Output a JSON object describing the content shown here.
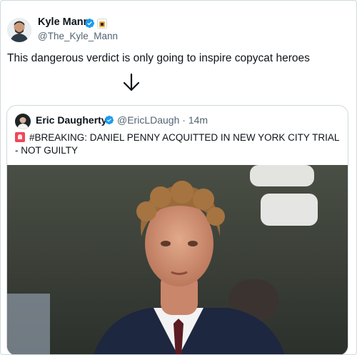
{
  "tweet": {
    "author_name": "Kyle Mann",
    "author_handle": "@The_Kyle_Mann",
    "text": "This dangerous verdict is only going to inspire copycat heroes",
    "arrow_icon": "arrow-down-icon"
  },
  "quote": {
    "author_name": "Eric Daugherty",
    "author_handle": "@EricLDaugh",
    "separator": "·",
    "time": "14m",
    "text": "#BREAKING: DANIEL PENNY ACQUITTED IN NEW YORK CITY TRIAL - NOT GUILTY",
    "emoji_icon": "police-light-icon"
  },
  "colors": {
    "verified_blue": "#1d9bf0",
    "text_primary": "#0f1419",
    "text_secondary": "#536471",
    "border": "#cfd9de"
  }
}
